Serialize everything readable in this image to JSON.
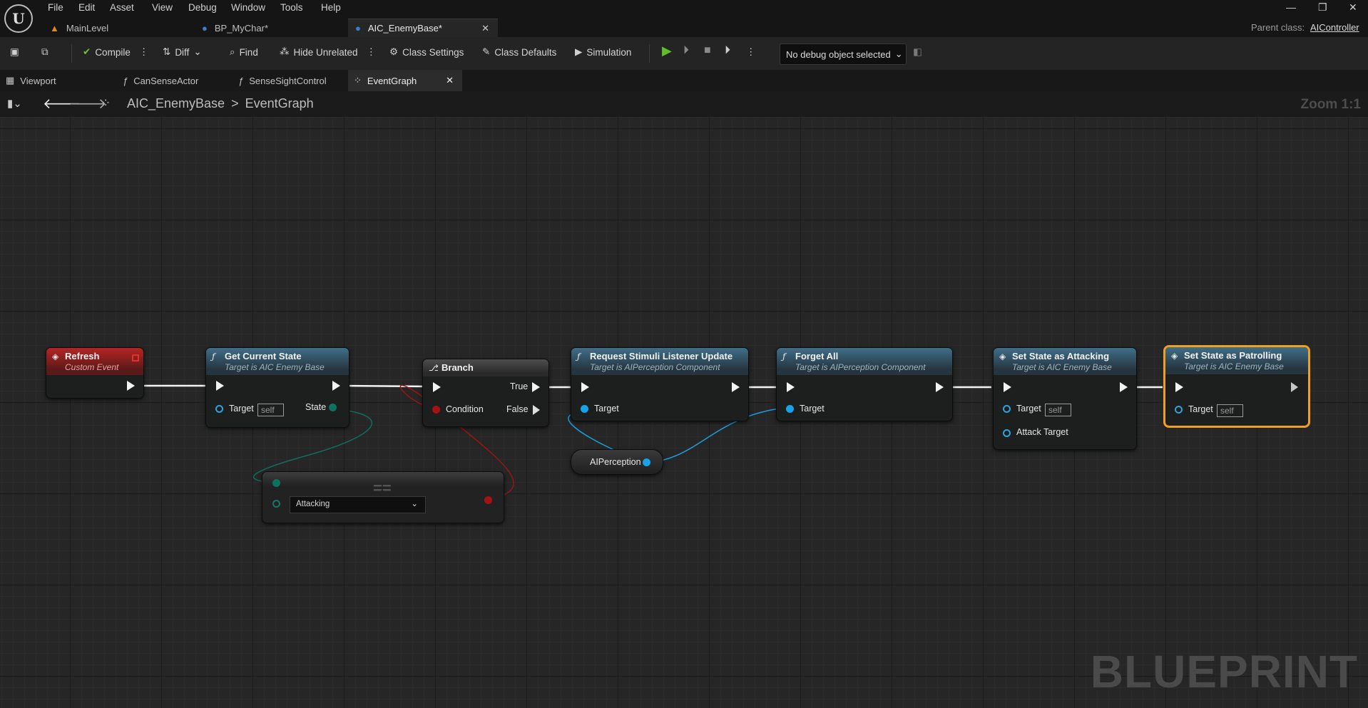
{
  "menu": [
    "File",
    "Edit",
    "Asset",
    "View",
    "Debug",
    "Window",
    "Tools",
    "Help"
  ],
  "doc_tabs": [
    {
      "label": "MainLevel"
    },
    {
      "label": "BP_MyChar*"
    },
    {
      "label": "AIC_EnemyBase*"
    }
  ],
  "parent_class": {
    "label": "Parent class:",
    "value": "AIController"
  },
  "toolbar": {
    "compile": "Compile",
    "diff": "Diff",
    "find": "Find",
    "hide_unrelated": "Hide Unrelated",
    "class_settings": "Class Settings",
    "class_defaults": "Class Defaults",
    "simulation": "Simulation",
    "debug_object": "No debug object selected"
  },
  "sub_tabs": [
    "Viewport",
    "CanSenseActor",
    "SenseSightControl",
    "EventGraph"
  ],
  "breadcrumb": {
    "root": "AIC_EnemyBase",
    "sep": ">",
    "current": "EventGraph"
  },
  "zoom": "Zoom 1:1",
  "watermark": "BLUEPRINT",
  "nodes": {
    "refresh": {
      "title": "Refresh",
      "subtitle": "Custom Event"
    },
    "get_state": {
      "title": "Get Current State",
      "subtitle": "Target is AIC Enemy Base",
      "target": "Target",
      "self": "self",
      "state": "State"
    },
    "branch": {
      "title": "Branch",
      "true": "True",
      "false": "False",
      "condition": "Condition"
    },
    "equal": {
      "title": "==",
      "enum_value": "Attacking"
    },
    "request": {
      "title": "Request Stimuli Listener Update",
      "subtitle": "Target is AIPerception Component",
      "target": "Target"
    },
    "aiperception": {
      "label": "AIPerception"
    },
    "forget": {
      "title": "Forget All",
      "subtitle": "Target is AIPerception Component",
      "target": "Target"
    },
    "attacking": {
      "title": "Set State as Attacking",
      "subtitle": "Target is AIC Enemy Base",
      "target": "Target",
      "self": "self",
      "attack_target": "Attack Target"
    },
    "patrolling": {
      "title": "Set State as Patrolling",
      "subtitle": "Target is AIC Enemy Base",
      "target": "Target",
      "self": "self"
    }
  },
  "colors": {
    "exec": "#f3f3f3",
    "object": "#18a2e8",
    "bool": "#a31313",
    "enum": "#0e7263",
    "selected": "#f0a020",
    "header_blue": "#3f6f88",
    "header_red": "#b52424"
  }
}
